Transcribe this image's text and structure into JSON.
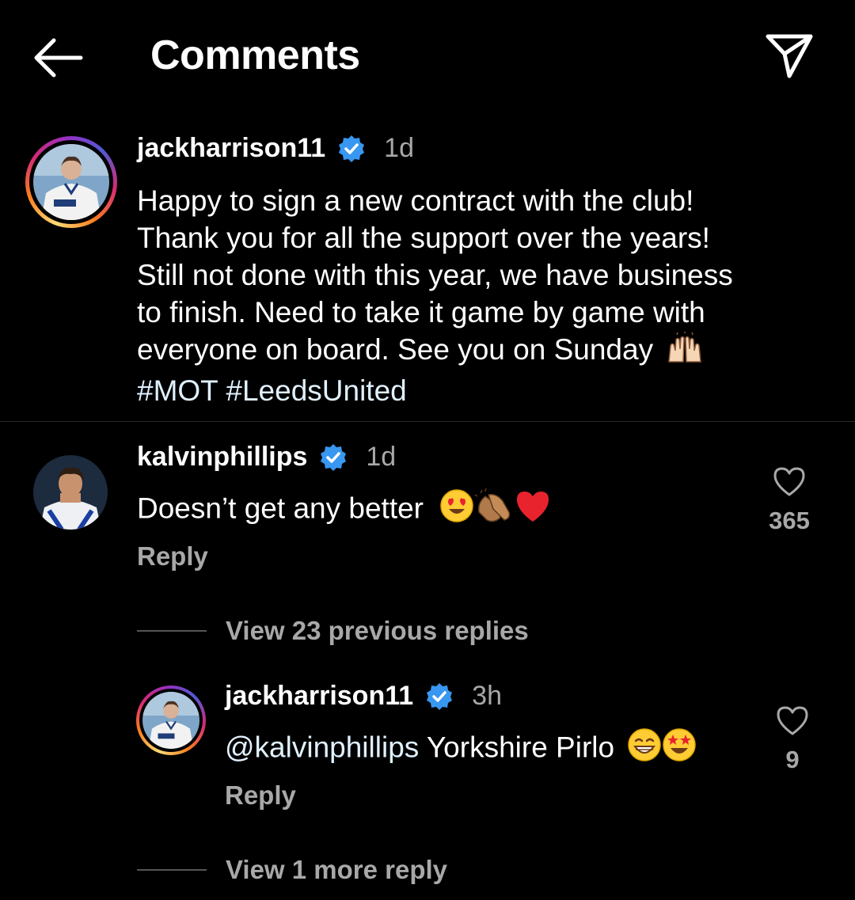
{
  "header": {
    "title": "Comments"
  },
  "caption": {
    "username": "jackharrison11",
    "time": "1d",
    "lines": [
      "Happy to sign a new contract with the club!",
      "Thank you for all the support over the years!",
      "Still not done with this year, we have business",
      "to finish. Need to take it game by game with",
      "everyone on board. See you on Sunday"
    ],
    "hashtags": "#MOT #LeedsUnited"
  },
  "comment": {
    "username": "kalvinphillips",
    "time": "1d",
    "text": "Doesn’t get any better",
    "reply_label": "Reply",
    "likes": "365",
    "view_replies": "View 23 previous replies"
  },
  "reply": {
    "username": "jackharrison11",
    "time": "3h",
    "mention": "@kalvinphillips",
    "text": " Yorkshire Pirlo",
    "reply_label": "Reply",
    "likes": "9",
    "view_more": "View 1 more reply"
  },
  "colors": {
    "background": "#000000",
    "secondary_text": "#a8a8a8",
    "verified_blue": "#3897f0",
    "link_text": "#e0f1ff"
  }
}
